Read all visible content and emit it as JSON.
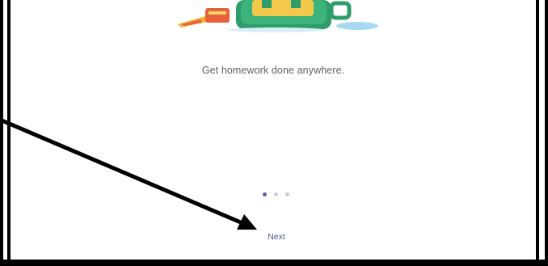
{
  "onboarding": {
    "tagline": "Get homework done anywhere.",
    "next_label": "Next",
    "page_indicator": {
      "total": 3,
      "current": 1
    }
  },
  "colors": {
    "dot_active": "#5b5fa6",
    "dot_inactive": "#c9cbe6",
    "next_text": "#4a5488",
    "tagline_text": "#5f5f66"
  },
  "illustration": {
    "icon": "homework-backpack-illustration"
  }
}
